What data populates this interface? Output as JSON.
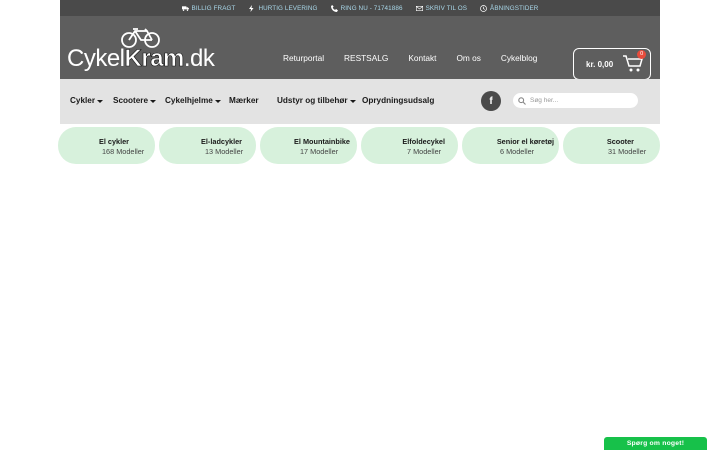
{
  "topbar": {
    "items": [
      {
        "icon": "truck-icon",
        "label": "BILLIG FRAGT"
      },
      {
        "icon": "bolt-icon",
        "label": "HURTIG LEVERING"
      },
      {
        "icon": "phone-icon",
        "label": "RING NU - 71741886"
      },
      {
        "icon": "envelope-icon",
        "label": "SKRIV TIL OS"
      },
      {
        "icon": "clock-icon",
        "label": "ÅBNINGSTIDER"
      }
    ]
  },
  "header": {
    "logo_text_1": "Cykel",
    "logo_text_2": "Kram",
    "logo_text_3": ".dk",
    "nav": [
      "Returportal",
      "RESTSALG",
      "Kontakt",
      "Om os",
      "Cykelblog"
    ],
    "cart_amount": "kr. 0,00",
    "cart_count": "0"
  },
  "catnav": {
    "items": [
      {
        "label": "Cykler",
        "dropdown": true
      },
      {
        "label": "Scootere",
        "dropdown": true
      },
      {
        "label": "Cykelhjelme",
        "dropdown": true
      },
      {
        "label": "Mærker",
        "dropdown": false
      },
      {
        "label": "Udstyr og tilbehør",
        "dropdown": true
      },
      {
        "label": "Oprydningsudsalg",
        "dropdown": false
      }
    ],
    "facebook_glyph": "f",
    "search_placeholder": "Søg her..."
  },
  "categories": [
    {
      "name": "El cykler",
      "count": "168 Modeller"
    },
    {
      "name": "El-ladcykler",
      "count": "13 Modeller"
    },
    {
      "name": "El Mountainbike",
      "count": "17 Modeller"
    },
    {
      "name": "Elfoldecykel",
      "count": "7 Modeller"
    },
    {
      "name": "Senior el køretøj",
      "count": "6 Modeller"
    },
    {
      "name": "Scooter",
      "count": "31 Modeller"
    }
  ],
  "chat": {
    "label": "Spørg om noget!"
  },
  "colors": {
    "topbar": "#4a4a4a",
    "header": "#5e5e5e",
    "catnav": "#e3e3e3",
    "tile": "#d7f1dc",
    "chat": "#17c14a",
    "topbar_text": "#a9d8ea"
  }
}
